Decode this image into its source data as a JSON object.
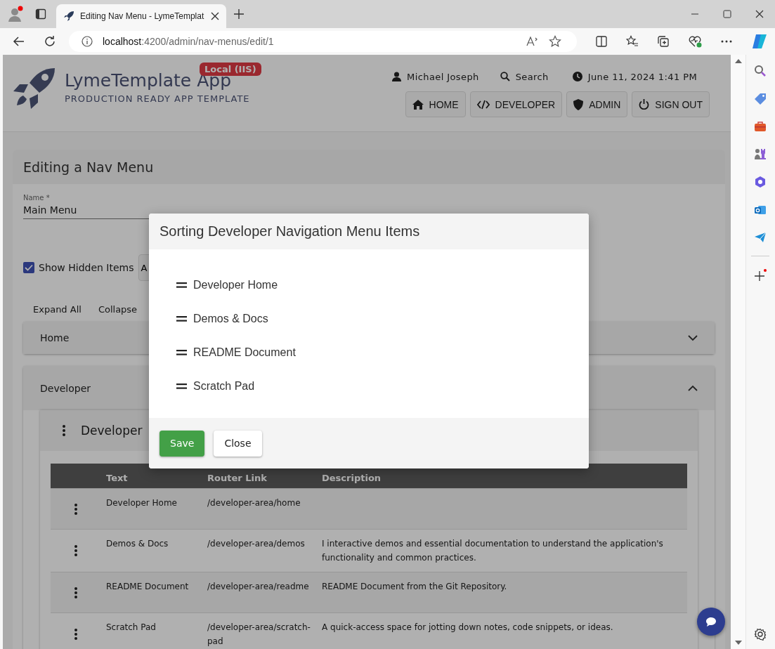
{
  "browser": {
    "tab_title": "Editing Nav Menu - LymeTemplat",
    "url_host": "localhost",
    "url_path": ":4200/admin/nav-menus/edit/1"
  },
  "header": {
    "app_name": "LymeTemplate App",
    "tagline": "PRODUCTION READY APP TEMPLATE",
    "env_badge": "Local (IIS)",
    "user": "Michael Joseph",
    "search": "Search",
    "datetime": "June 11, 2024 1:41 PM",
    "nav": [
      {
        "label": "HOME"
      },
      {
        "label": "DEVELOPER"
      },
      {
        "label": "ADMIN"
      },
      {
        "label": "SIGN OUT"
      }
    ]
  },
  "card": {
    "title": "Editing a Nav Menu",
    "name_field": {
      "label": "Name *",
      "value": "Main Menu"
    },
    "show_hidden": {
      "label": "Show Hidden Items",
      "checked": true
    },
    "partial_button": "A",
    "expand_all": "Expand All",
    "collapse": "Collapse",
    "sections": [
      {
        "title": "Home",
        "expanded": false
      },
      {
        "title": "Developer",
        "expanded": true,
        "group": {
          "title": "Developer",
          "table": {
            "columns": [
              "Text",
              "Router Link",
              "Description"
            ],
            "rows": [
              {
                "text": "Developer Home",
                "router_link": "/developer-area/home"
              },
              {
                "text": "Demos & Docs",
                "router_link": "/developer-area/demos",
                "description": "I interactive demos and essential documentation to understand the application's functionality and common practices."
              },
              {
                "text": "README Document",
                "router_link": "/developer-area/readme",
                "description": "README Document from the Git Repository."
              },
              {
                "text": "Scratch Pad",
                "router_link": "/developer-area/scratch-pad",
                "description": "A quick-access space for jotting down notes, code snippets, or ideas."
              }
            ]
          }
        }
      }
    ]
  },
  "modal": {
    "title": "Sorting Developer Navigation Menu Items",
    "items": [
      "Developer Home",
      "Demos & Docs",
      "README Document",
      "Scratch Pad"
    ],
    "buttons": [
      {
        "label": "Save",
        "kind": "primary"
      },
      {
        "label": "Close",
        "kind": "default"
      }
    ]
  }
}
